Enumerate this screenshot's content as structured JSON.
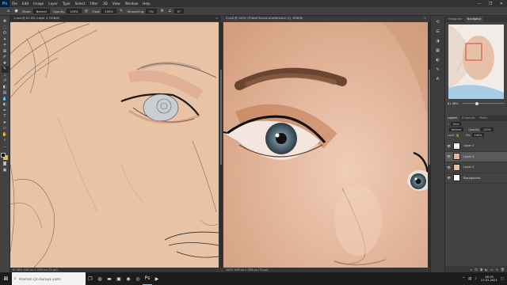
{
  "menubar": {
    "logo": "Ps",
    "items": [
      "File",
      "Edit",
      "Image",
      "Layer",
      "Type",
      "Select",
      "Filter",
      "3D",
      "View",
      "Window",
      "Help"
    ],
    "controls": [
      "—",
      "❐",
      "✕"
    ]
  },
  "options": {
    "mode_label": "Mode:",
    "mode_value": "Normal",
    "opacity_label": "Opacity:",
    "opacity_value": "100%",
    "flow_label": "Flow:",
    "flow_value": "100%",
    "smoothing_label": "Smoothing:",
    "smoothing_value": "0%",
    "angle_value": "0°"
  },
  "tabs": {
    "left": "1.psd @ 81.4% (Layer 3, RGB/8)",
    "right": "2.psd @ 100% (©Wolf Sanna-shutterstock (1), RGB/8)"
  },
  "status": {
    "left": "81.38%    1000 px x 1500 px (72 ppi)",
    "right": "100%    1000 px x 1500 px (72 ppi)"
  },
  "panels": {
    "nav_tabs": [
      "Histogram",
      "Navigator"
    ],
    "zoom": "81.38%",
    "layer_tabs": [
      "Layers",
      "Channels",
      "Paths"
    ],
    "kind_label": "Kind",
    "blend_mode": "Normal",
    "opacity_label": "Opacity:",
    "opacity_value": "100%",
    "lock_label": "Lock:",
    "fill_label": "Fill:",
    "fill_value": "100%",
    "layers": [
      {
        "name": "Layer 1",
        "color": "#f2efe9",
        "selected": false
      },
      {
        "name": "Layer 3",
        "color": "#e2b79a",
        "selected": true
      },
      {
        "name": "Layer 2",
        "color": "#e6bfa3",
        "selected": false
      },
      {
        "name": "Background",
        "color": "#ffffff",
        "selected": false
      }
    ]
  },
  "taskbar": {
    "search_placeholder": "Aramak için buraya yazın",
    "time": "16:19",
    "date": "27.01.2021"
  },
  "colors": {
    "foreground": "#111111",
    "background": "#f5c400",
    "skin_left": "#e9c3a6",
    "skin_right": "#d9a98b"
  }
}
